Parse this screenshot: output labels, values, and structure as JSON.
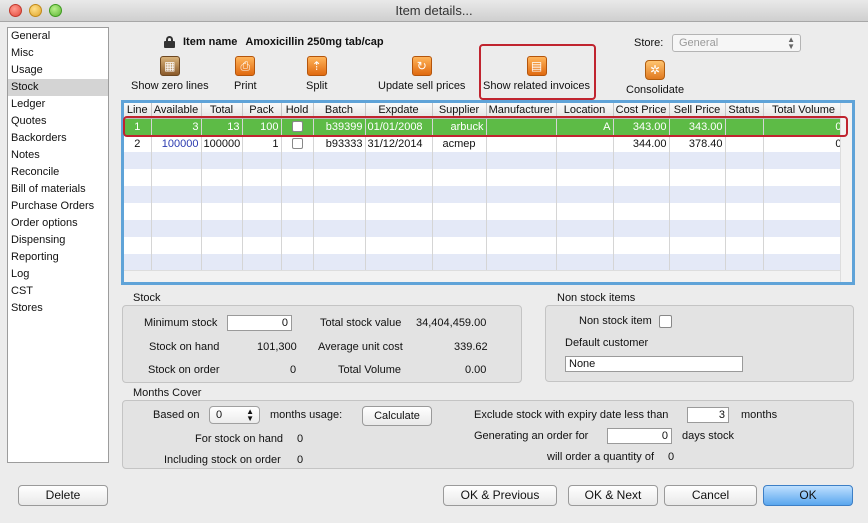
{
  "window": {
    "title": "Item details..."
  },
  "sidebar": {
    "items": [
      {
        "label": "General"
      },
      {
        "label": "Misc"
      },
      {
        "label": "Usage"
      },
      {
        "label": "Stock",
        "selected": true
      },
      {
        "label": "Ledger"
      },
      {
        "label": "Quotes"
      },
      {
        "label": "Backorders"
      },
      {
        "label": "Notes"
      },
      {
        "label": "Reconcile"
      },
      {
        "label": "Bill of materials"
      },
      {
        "label": "Purchase Orders"
      },
      {
        "label": "Order options"
      },
      {
        "label": "Dispensing"
      },
      {
        "label": "Reporting"
      },
      {
        "label": "Log"
      },
      {
        "label": "CST"
      },
      {
        "label": "Stores"
      }
    ]
  },
  "header": {
    "item_name_label": "Item name",
    "item_name": "Amoxicillin 250mg tab/cap",
    "store_label": "Store:",
    "store_value": "General"
  },
  "toolbar": {
    "show_zero_lines": "Show zero lines",
    "print": "Print",
    "split": "Split",
    "update_sell_prices": "Update sell prices",
    "show_related_invoices": "Show related invoices",
    "consolidate": "Consolidate"
  },
  "grid": {
    "columns": [
      "Line",
      "Available",
      "Total",
      "Pack",
      "Hold",
      "Batch",
      "Expdate",
      "Supplier",
      "Manufacturer",
      "Location",
      "Cost Price",
      "Sell Price",
      "Status",
      "Total Volume"
    ],
    "rows": [
      {
        "line": "1",
        "available": "3",
        "total": "13",
        "pack": "100",
        "batch": "b39399",
        "expdate": "01/01/2008",
        "supplier": "arbuck",
        "manufacturer": "",
        "location": "A",
        "cost_price": "343.00",
        "sell_price": "343.00",
        "status": "",
        "total_volume": "0"
      },
      {
        "line": "2",
        "available": "100000",
        "total": "100000",
        "pack": "1",
        "batch": "b93333",
        "expdate": "31/12/2014",
        "supplier": "acmep",
        "manufacturer": "",
        "location": "",
        "cost_price": "344.00",
        "sell_price": "378.40",
        "status": "",
        "total_volume": "0"
      }
    ]
  },
  "stock": {
    "title": "Stock",
    "minimum_stock_label": "Minimum stock",
    "minimum_stock_value": "0",
    "total_stock_value_label": "Total stock value",
    "total_stock_value": "34,404,459.00",
    "stock_on_hand_label": "Stock on hand",
    "stock_on_hand": "101,300",
    "average_unit_cost_label": "Average unit cost",
    "average_unit_cost": "339.62",
    "stock_on_order_label": "Stock on order",
    "stock_on_order": "0",
    "total_volume_label": "Total Volume",
    "total_volume": "0.00"
  },
  "non_stock": {
    "title": "Non stock items",
    "non_stock_item_label": "Non stock item",
    "default_customer_label": "Default customer",
    "default_customer_value": "None"
  },
  "months_cover": {
    "title": "Months Cover",
    "based_on_label": "Based on",
    "based_on_value": "0",
    "months_usage_label": "months usage:",
    "calculate_label": "Calculate",
    "for_stock_on_hand_label": "For stock on hand",
    "for_stock_on_hand": "0",
    "including_stock_on_order_label": "Including stock on order",
    "including_stock_on_order": "0",
    "exclude_label": "Exclude stock with expiry date less than",
    "exclude_value": "3",
    "months_label": "months",
    "generating_label": "Generating an order for",
    "generating_value": "0",
    "days_stock_label": "days stock",
    "will_order_label": "will order a quantity of",
    "will_order_value": "0"
  },
  "buttons": {
    "delete": "Delete",
    "ok_previous": "OK & Previous",
    "ok_next": "OK & Next",
    "cancel": "Cancel",
    "ok": "OK"
  }
}
